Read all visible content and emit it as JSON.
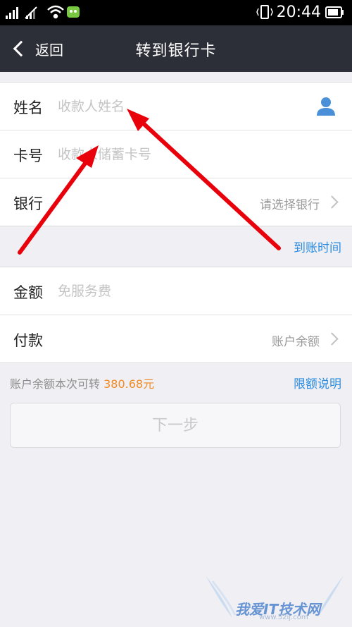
{
  "status_bar": {
    "time": "20:44"
  },
  "nav": {
    "back_label": "返回",
    "title": "转到银行卡"
  },
  "form": {
    "name": {
      "label": "姓名",
      "placeholder": "收款人姓名"
    },
    "card": {
      "label": "卡号",
      "placeholder": "收款人储蓄卡号"
    },
    "bank": {
      "label": "银行",
      "value": "请选择银行"
    }
  },
  "arrival_time_link": "到账时间",
  "amount": {
    "label": "金额",
    "placeholder": "免服务费"
  },
  "payment": {
    "label": "付款",
    "value": "账户余额"
  },
  "balance": {
    "text": "账户余额本次可转",
    "amount": "380.68元"
  },
  "limit_link": "限额说明",
  "next_button": "下一步",
  "watermark": {
    "text": "我爱IT技术网",
    "url": "www.52ij.com"
  },
  "colors": {
    "nav_bg": "#2c2f38",
    "link": "#2a8ce0",
    "amount": "#f08a24",
    "annotation_arrow": "#e8000b"
  }
}
